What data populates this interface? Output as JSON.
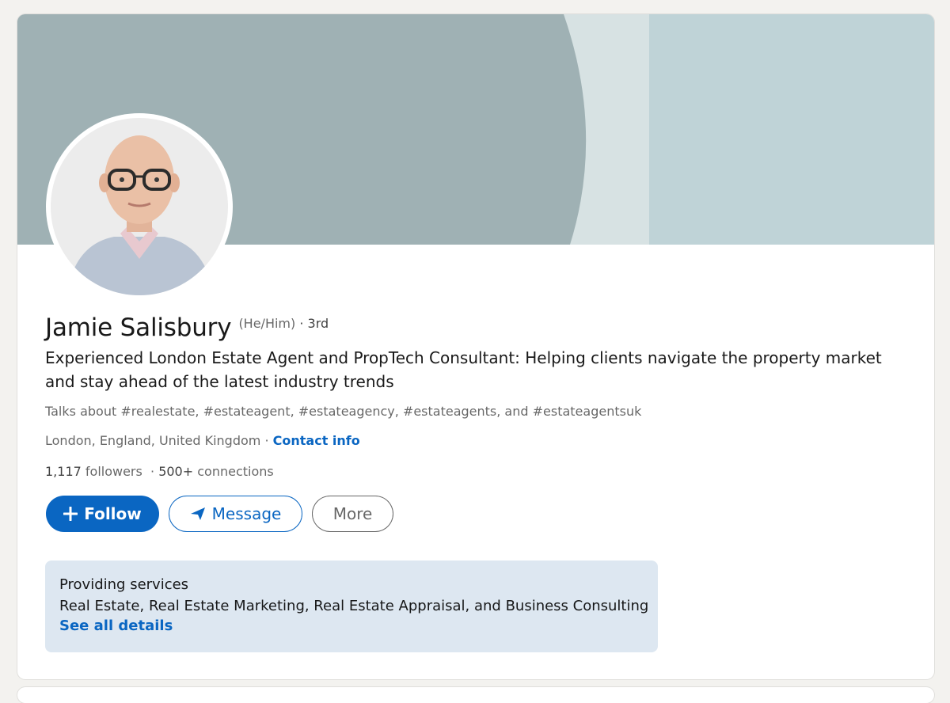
{
  "profile": {
    "name": "Jamie Salisbury",
    "pronouns": "(He/Him)",
    "degree": "· 3rd",
    "headline": "Experienced London Estate Agent and PropTech Consultant: Helping clients navigate the property market and stay ahead of the latest industry trends",
    "talks_about": "Talks about #realestate, #estateagent, #estateagency, #estateagents, and #estateagentsuk",
    "location": "London, England, United Kingdom",
    "location_separator": " · ",
    "contact_info": "Contact info",
    "followers_count": "1,117",
    "followers_label": " followers",
    "connections_separator": "  · ",
    "connections_count": "500+",
    "connections_label": " connections"
  },
  "actions": {
    "follow_label": "Follow",
    "message_label": "Message",
    "more_label": "More"
  },
  "services": {
    "title": "Providing services",
    "list": "Real Estate, Real Estate Marketing, Real Estate Appraisal, and Business Consulting",
    "link": "See all details"
  },
  "icons": {
    "follow": "plus-icon",
    "message": "send-icon"
  },
  "colors": {
    "accent": "#0a66c2",
    "banner_dark": "#9fb1b4",
    "banner_light": "#bfd3d7",
    "banner_stripe": "#d7e2e3",
    "services_bg": "#dde7f1",
    "page_bg": "#f3f2ef"
  }
}
